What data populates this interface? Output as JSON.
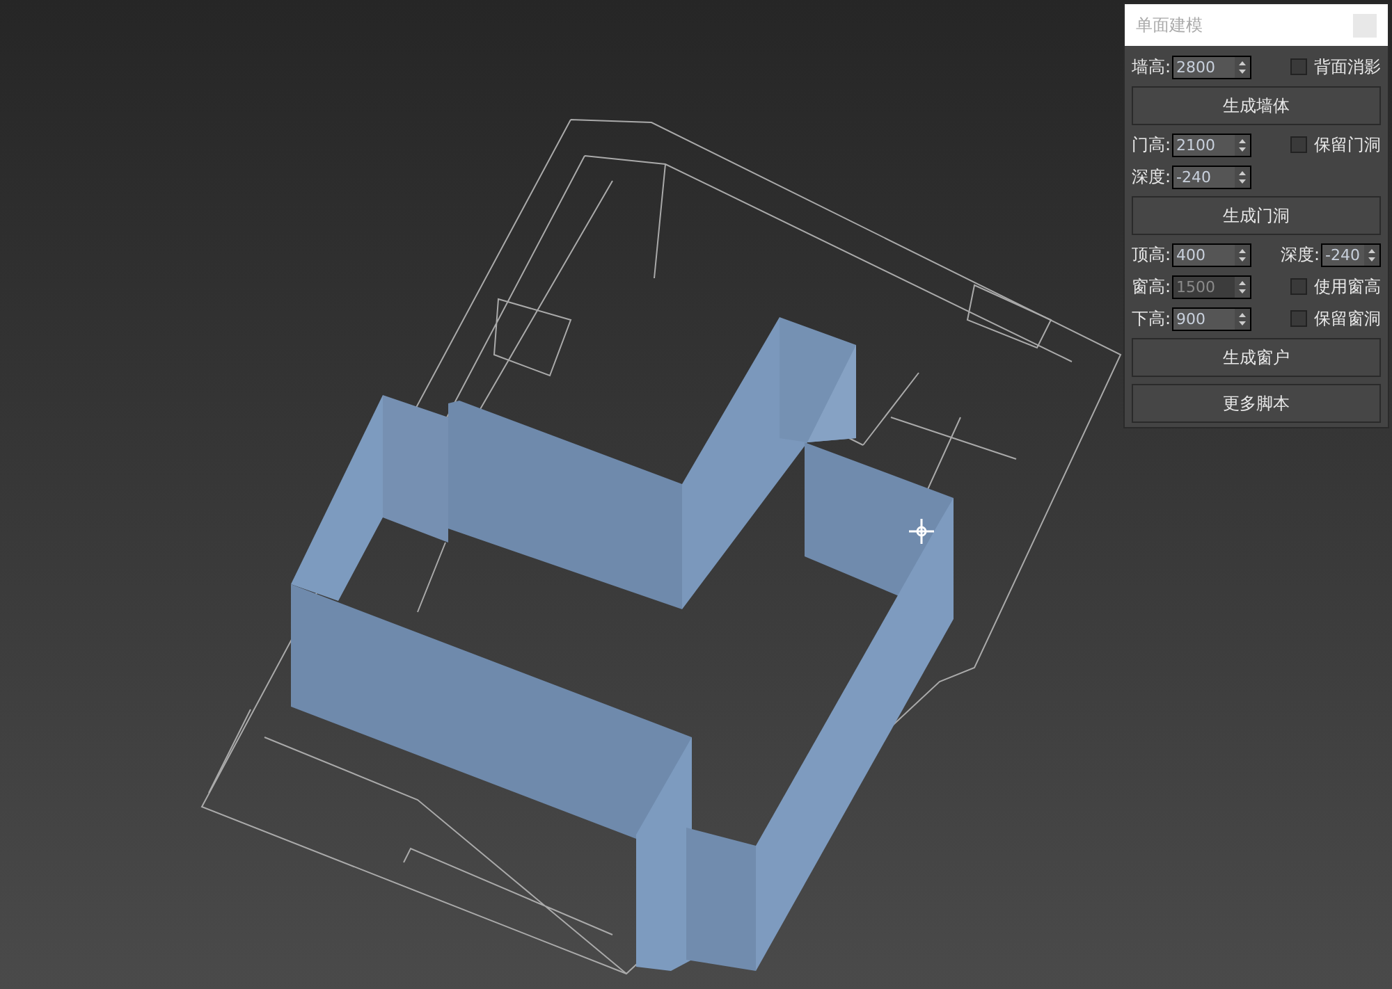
{
  "panel": {
    "title": "单面建模",
    "rows": [
      {
        "items": [
          {
            "kind": "spinner",
            "label": "墙高:",
            "value": "2800",
            "disabled": false
          },
          {
            "kind": "checkbox",
            "label": "背面消影",
            "checked": false
          }
        ]
      },
      {
        "items": [
          {
            "kind": "button",
            "label": "生成墙体"
          }
        ]
      },
      {
        "items": [
          {
            "kind": "spinner",
            "label": "门高:",
            "value": "2100",
            "disabled": false
          },
          {
            "kind": "checkbox",
            "label": "保留门洞",
            "checked": false
          }
        ]
      },
      {
        "items": [
          {
            "kind": "spinner",
            "label": "深度:",
            "value": "-240",
            "disabled": false
          }
        ]
      },
      {
        "items": [
          {
            "kind": "button",
            "label": "生成门洞"
          }
        ]
      },
      {
        "items": [
          {
            "kind": "spinner",
            "label": "顶高:",
            "value": "400",
            "disabled": false
          },
          {
            "kind": "small_spinner",
            "label": "深度:",
            "value": "-240",
            "disabled": false
          }
        ]
      },
      {
        "items": [
          {
            "kind": "spinner",
            "label": "窗高:",
            "value": "1500",
            "disabled": true
          },
          {
            "kind": "checkbox",
            "label": "使用窗高",
            "checked": false
          }
        ]
      },
      {
        "items": [
          {
            "kind": "spinner",
            "label": "下高:",
            "value": "900",
            "disabled": false
          },
          {
            "kind": "checkbox",
            "label": "保留窗洞",
            "checked": false
          }
        ]
      },
      {
        "items": [
          {
            "kind": "button",
            "label": "生成窗户"
          }
        ]
      },
      {
        "items": [
          {
            "kind": "button",
            "label": "更多脚本"
          }
        ]
      }
    ]
  }
}
